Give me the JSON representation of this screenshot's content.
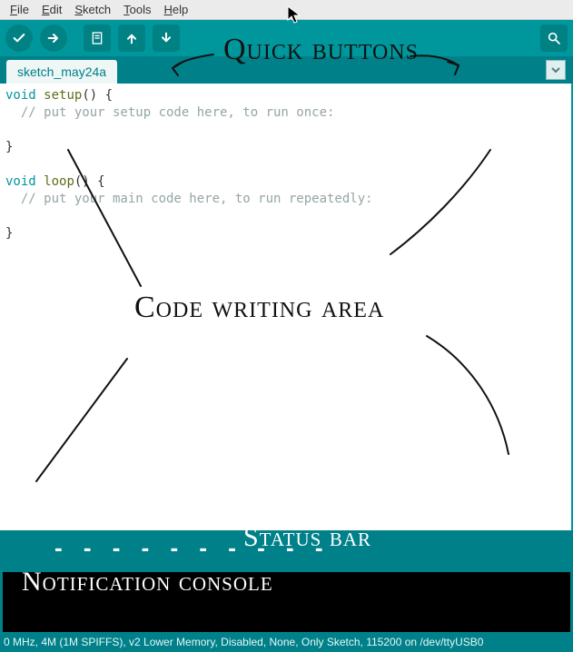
{
  "menubar": {
    "items": [
      {
        "key": "F",
        "rest": "ile"
      },
      {
        "key": "E",
        "rest": "dit"
      },
      {
        "key": "S",
        "rest": "ketch"
      },
      {
        "key": "T",
        "rest": "ools"
      },
      {
        "key": "H",
        "rest": "elp"
      }
    ]
  },
  "toolbar": {
    "verify": "verify-icon",
    "upload": "upload-arrow-icon",
    "new": "new-file-icon",
    "open": "open-up-icon",
    "save": "save-down-icon",
    "monitor": "serial-monitor-icon"
  },
  "tab": {
    "name": "sketch_may24a"
  },
  "code": {
    "l1_kw": "void",
    "l1_fn": "setup",
    "l1_rest": "() {",
    "l2": "  // put your setup code here, to run once:",
    "l3": "",
    "l4": "}",
    "l5": "",
    "l6_kw": "void",
    "l6_fn": "loop",
    "l6_rest": "() {",
    "l7": "  // put your main code here, to run repeatedly:",
    "l8": "",
    "l9": "}"
  },
  "status_text": "",
  "console_text": "",
  "footer_text": "0 MHz, 4M (1M SPIFFS), v2 Lower Memory, Disabled, None, Only Sketch, 115200 on /dev/ttyUSB0",
  "annotations": {
    "quick": "Quick buttons",
    "code": "Code writing area",
    "status": "Status bar",
    "console": "Notification console"
  }
}
